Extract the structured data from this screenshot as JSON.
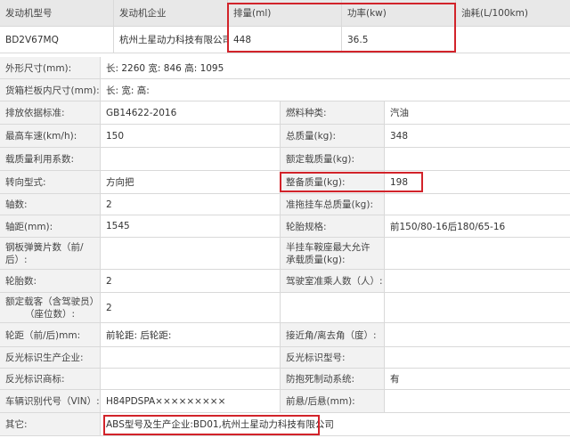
{
  "header": {
    "engine_model": "发动机型号",
    "engine_company": "发动机企业",
    "displacement": "排量(ml)",
    "power": "功率(kw)",
    "fuel_consumption": "油耗(L/100km)"
  },
  "engine_row": {
    "model": "BD2V67MQ",
    "company": "杭州土星动力科技有限公司",
    "displacement": "448",
    "power": "36.5",
    "fuel_consumption": ""
  },
  "rows": {
    "outer_dims": {
      "label": "外形尺寸(mm):",
      "value": "长: 2260 宽: 846 高: 1095"
    },
    "cargo_dims": {
      "label": "货箱栏板内尺寸(mm):",
      "value": "长:  宽:  高:"
    },
    "emission": {
      "label": "排放依据标准:",
      "value": "GB14622-2016",
      "label2": "燃料种类:",
      "value2": "汽油"
    },
    "max_speed": {
      "label": "最高车速(km/h):",
      "value": "150",
      "label2": "总质量(kg):",
      "value2": "348"
    },
    "load_util": {
      "label": "载质量利用系数:",
      "value": "",
      "label2": "额定载质量(kg):",
      "value2": ""
    },
    "steering": {
      "label": "转向型式:",
      "value": "方向把",
      "label2": "整备质量(kg):",
      "value2": "198"
    },
    "axles": {
      "label": "轴数:",
      "value": "2",
      "label2": "准拖挂车总质量(kg):",
      "value2": ""
    },
    "wheelbase": {
      "label": "轴距(mm):",
      "value": "1545",
      "label2": "轮胎规格:",
      "value2": "前150/80-16后180/65-16"
    },
    "leaf_springs": {
      "label": "钢板弹簧片数（前/后）:",
      "value": "",
      "label2": "半挂车鞍座最大允许承载质量(kg):",
      "value2": ""
    },
    "tires": {
      "label": "轮胎数:",
      "value": "2",
      "label2": "驾驶室准乘人数（人）:",
      "value2": ""
    },
    "seats": {
      "label": "额定载客（含驾驶员）（座位数）:",
      "value": "2",
      "label2": "",
      "value2": ""
    },
    "track": {
      "label": "轮距（前/后)mm:",
      "value": "前轮距: 后轮距:",
      "label2": "接近角/离去角（度）:",
      "value2": ""
    },
    "reflector_company": {
      "label": "反光标识生产企业:",
      "value": "",
      "label2": "反光标识型号:",
      "value2": ""
    },
    "reflector_brand": {
      "label": "反光标识商标:",
      "value": "",
      "label2": "防抱死制动系统:",
      "value2": "有"
    },
    "vin": {
      "label": "车辆识别代号（VIN）:",
      "value": "H84PDSPA×××××××××",
      "label2": "前悬/后悬(mm):",
      "value2": ""
    },
    "other": {
      "label": "其它:",
      "value": "ABS型号及生产企业:BD01,杭州土星动力科技有限公司"
    }
  },
  "colors": {
    "highlight": "#d2232a",
    "label_bg": "#f2f2f2",
    "header_bg": "#e8e8e8",
    "grid": "#d9d9d9"
  }
}
